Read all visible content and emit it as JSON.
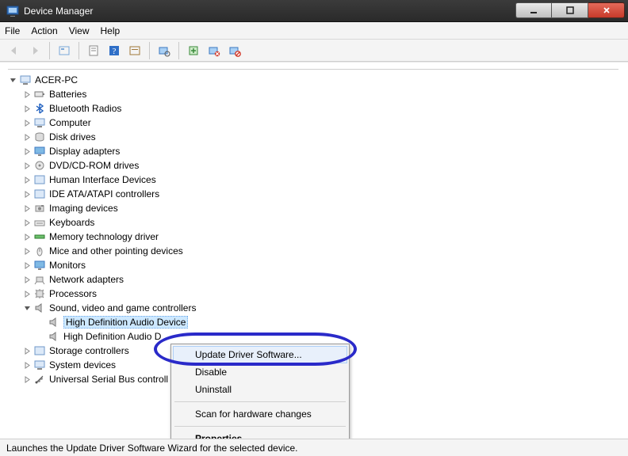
{
  "titlebar": {
    "title": "Device Manager"
  },
  "menubar": {
    "items": [
      "File",
      "Action",
      "View",
      "Help"
    ]
  },
  "tree": {
    "root": "ACER-PC",
    "nodes": [
      {
        "label": "Batteries"
      },
      {
        "label": "Bluetooth Radios"
      },
      {
        "label": "Computer"
      },
      {
        "label": "Disk drives"
      },
      {
        "label": "Display adapters"
      },
      {
        "label": "DVD/CD-ROM drives"
      },
      {
        "label": "Human Interface Devices"
      },
      {
        "label": "IDE ATA/ATAPI controllers"
      },
      {
        "label": "Imaging devices"
      },
      {
        "label": "Keyboards"
      },
      {
        "label": "Memory technology driver"
      },
      {
        "label": "Mice and other pointing devices"
      },
      {
        "label": "Monitors"
      },
      {
        "label": "Network adapters"
      },
      {
        "label": "Processors"
      },
      {
        "label": "Sound, video and game controllers",
        "expanded": true,
        "children": [
          {
            "label": "High Definition Audio Device",
            "selected": true
          },
          {
            "label": "High Definition Audio D"
          }
        ]
      },
      {
        "label": "Storage controllers"
      },
      {
        "label": "System devices"
      },
      {
        "label": "Universal Serial Bus controll"
      }
    ]
  },
  "context_menu": {
    "items": [
      {
        "label": "Update Driver Software...",
        "hover": true
      },
      {
        "label": "Disable"
      },
      {
        "label": "Uninstall"
      },
      {
        "sep": true
      },
      {
        "label": "Scan for hardware changes"
      },
      {
        "sep": true
      },
      {
        "label": "Properties",
        "bold": true
      }
    ]
  },
  "statusbar": {
    "text": "Launches the Update Driver Software Wizard for the selected device."
  }
}
